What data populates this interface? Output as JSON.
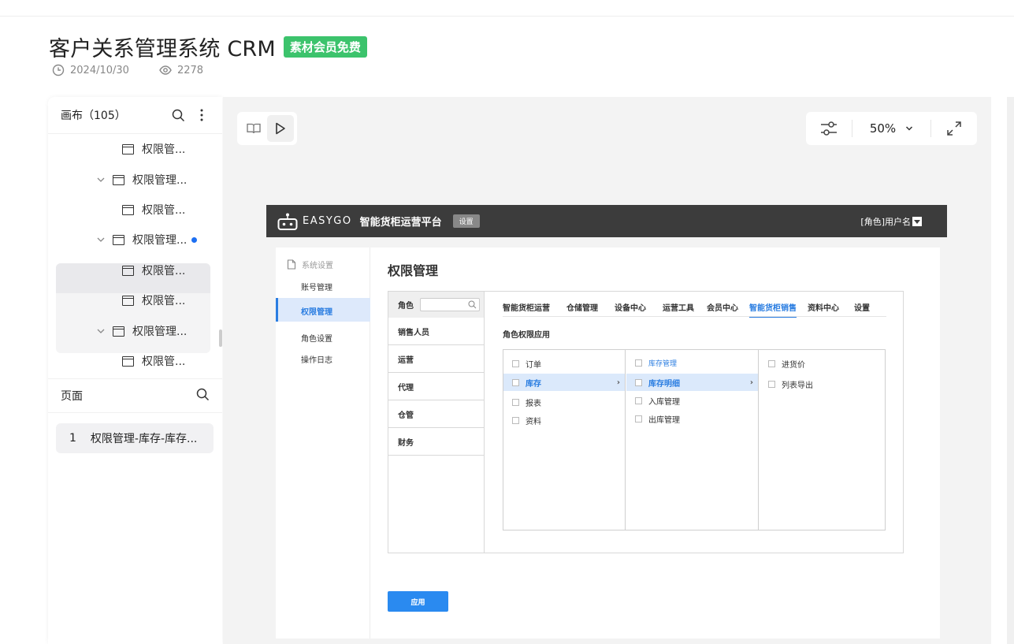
{
  "header": {
    "title": "客户关系管理系统 CRM",
    "badge": "素材会员免费",
    "date": "2024/10/30",
    "views": "2278"
  },
  "left_panel": {
    "canvas_title": "画布（105）",
    "tree": [
      {
        "label": "权限管...",
        "level": 2,
        "chevron": false
      },
      {
        "label": "权限管理...",
        "level": 1,
        "chevron": true
      },
      {
        "label": "权限管...",
        "level": 2,
        "chevron": false
      },
      {
        "label": "权限管理...",
        "level": 1,
        "chevron": true,
        "active": true
      },
      {
        "label": "权限管...",
        "level": 2,
        "chevron": false
      },
      {
        "label": "权限管...",
        "level": 2,
        "chevron": false
      },
      {
        "label": "权限管理...",
        "level": 1,
        "chevron": true
      },
      {
        "label": "权限管...",
        "level": 2,
        "chevron": false
      }
    ],
    "pages_title": "页面",
    "pages": [
      {
        "num": "1",
        "label": "权限管理-库存-库存..."
      }
    ]
  },
  "toolbar": {
    "zoom": "50%"
  },
  "prototype": {
    "logo_text": "EASYGO",
    "app_name": "智能货柜运营平台",
    "settings_tag": "设置",
    "user": "[角色]用户名",
    "sidebar": {
      "section": "系统设置",
      "items": [
        "账号管理",
        "权限管理",
        "角色设置",
        "操作日志"
      ],
      "active": "权限管理"
    },
    "page_title": "权限管理",
    "roles_header": "角色",
    "roles": [
      "销售人员",
      "运营",
      "代理",
      "仓管",
      "财务"
    ],
    "tabs": [
      "智能货柜运营",
      "仓储管理",
      "设备中心",
      "运营工具",
      "会员中心",
      "智能货柜销售",
      "资料中心",
      "设置"
    ],
    "active_tab": "智能货柜销售",
    "perm_title": "角色权限应用",
    "col1": [
      "订单",
      "库存",
      "报表",
      "资料"
    ],
    "col2_header": "库存管理",
    "col2": [
      "库存明细",
      "入库管理",
      "出库管理"
    ],
    "col3": [
      "进货价",
      "列表导出"
    ],
    "apply_button": "应用"
  },
  "colors": {
    "badge_green": "#3cc36c",
    "accent_blue": "#2a7de1",
    "proto_header": "#3c3c3c"
  }
}
